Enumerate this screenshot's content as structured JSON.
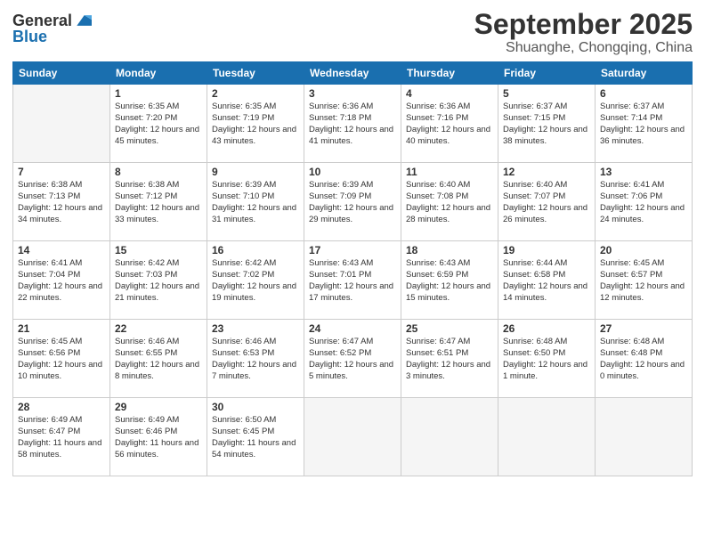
{
  "logo": {
    "general": "General",
    "blue": "Blue"
  },
  "title": "September 2025",
  "subtitle": "Shuanghe, Chongqing, China",
  "days_of_week": [
    "Sunday",
    "Monday",
    "Tuesday",
    "Wednesday",
    "Thursday",
    "Friday",
    "Saturday"
  ],
  "weeks": [
    [
      {
        "num": "",
        "empty": true
      },
      {
        "num": "1",
        "sunrise": "6:35 AM",
        "sunset": "7:20 PM",
        "daylight": "12 hours and 45 minutes."
      },
      {
        "num": "2",
        "sunrise": "6:35 AM",
        "sunset": "7:19 PM",
        "daylight": "12 hours and 43 minutes."
      },
      {
        "num": "3",
        "sunrise": "6:36 AM",
        "sunset": "7:18 PM",
        "daylight": "12 hours and 41 minutes."
      },
      {
        "num": "4",
        "sunrise": "6:36 AM",
        "sunset": "7:16 PM",
        "daylight": "12 hours and 40 minutes."
      },
      {
        "num": "5",
        "sunrise": "6:37 AM",
        "sunset": "7:15 PM",
        "daylight": "12 hours and 38 minutes."
      },
      {
        "num": "6",
        "sunrise": "6:37 AM",
        "sunset": "7:14 PM",
        "daylight": "12 hours and 36 minutes."
      }
    ],
    [
      {
        "num": "7",
        "sunrise": "6:38 AM",
        "sunset": "7:13 PM",
        "daylight": "12 hours and 34 minutes."
      },
      {
        "num": "8",
        "sunrise": "6:38 AM",
        "sunset": "7:12 PM",
        "daylight": "12 hours and 33 minutes."
      },
      {
        "num": "9",
        "sunrise": "6:39 AM",
        "sunset": "7:10 PM",
        "daylight": "12 hours and 31 minutes."
      },
      {
        "num": "10",
        "sunrise": "6:39 AM",
        "sunset": "7:09 PM",
        "daylight": "12 hours and 29 minutes."
      },
      {
        "num": "11",
        "sunrise": "6:40 AM",
        "sunset": "7:08 PM",
        "daylight": "12 hours and 28 minutes."
      },
      {
        "num": "12",
        "sunrise": "6:40 AM",
        "sunset": "7:07 PM",
        "daylight": "12 hours and 26 minutes."
      },
      {
        "num": "13",
        "sunrise": "6:41 AM",
        "sunset": "7:06 PM",
        "daylight": "12 hours and 24 minutes."
      }
    ],
    [
      {
        "num": "14",
        "sunrise": "6:41 AM",
        "sunset": "7:04 PM",
        "daylight": "12 hours and 22 minutes."
      },
      {
        "num": "15",
        "sunrise": "6:42 AM",
        "sunset": "7:03 PM",
        "daylight": "12 hours and 21 minutes."
      },
      {
        "num": "16",
        "sunrise": "6:42 AM",
        "sunset": "7:02 PM",
        "daylight": "12 hours and 19 minutes."
      },
      {
        "num": "17",
        "sunrise": "6:43 AM",
        "sunset": "7:01 PM",
        "daylight": "12 hours and 17 minutes."
      },
      {
        "num": "18",
        "sunrise": "6:43 AM",
        "sunset": "6:59 PM",
        "daylight": "12 hours and 15 minutes."
      },
      {
        "num": "19",
        "sunrise": "6:44 AM",
        "sunset": "6:58 PM",
        "daylight": "12 hours and 14 minutes."
      },
      {
        "num": "20",
        "sunrise": "6:45 AM",
        "sunset": "6:57 PM",
        "daylight": "12 hours and 12 minutes."
      }
    ],
    [
      {
        "num": "21",
        "sunrise": "6:45 AM",
        "sunset": "6:56 PM",
        "daylight": "12 hours and 10 minutes."
      },
      {
        "num": "22",
        "sunrise": "6:46 AM",
        "sunset": "6:55 PM",
        "daylight": "12 hours and 8 minutes."
      },
      {
        "num": "23",
        "sunrise": "6:46 AM",
        "sunset": "6:53 PM",
        "daylight": "12 hours and 7 minutes."
      },
      {
        "num": "24",
        "sunrise": "6:47 AM",
        "sunset": "6:52 PM",
        "daylight": "12 hours and 5 minutes."
      },
      {
        "num": "25",
        "sunrise": "6:47 AM",
        "sunset": "6:51 PM",
        "daylight": "12 hours and 3 minutes."
      },
      {
        "num": "26",
        "sunrise": "6:48 AM",
        "sunset": "6:50 PM",
        "daylight": "12 hours and 1 minute."
      },
      {
        "num": "27",
        "sunrise": "6:48 AM",
        "sunset": "6:48 PM",
        "daylight": "12 hours and 0 minutes."
      }
    ],
    [
      {
        "num": "28",
        "sunrise": "6:49 AM",
        "sunset": "6:47 PM",
        "daylight": "11 hours and 58 minutes."
      },
      {
        "num": "29",
        "sunrise": "6:49 AM",
        "sunset": "6:46 PM",
        "daylight": "11 hours and 56 minutes."
      },
      {
        "num": "30",
        "sunrise": "6:50 AM",
        "sunset": "6:45 PM",
        "daylight": "11 hours and 54 minutes."
      },
      {
        "num": "",
        "empty": true
      },
      {
        "num": "",
        "empty": true
      },
      {
        "num": "",
        "empty": true
      },
      {
        "num": "",
        "empty": true
      }
    ]
  ]
}
